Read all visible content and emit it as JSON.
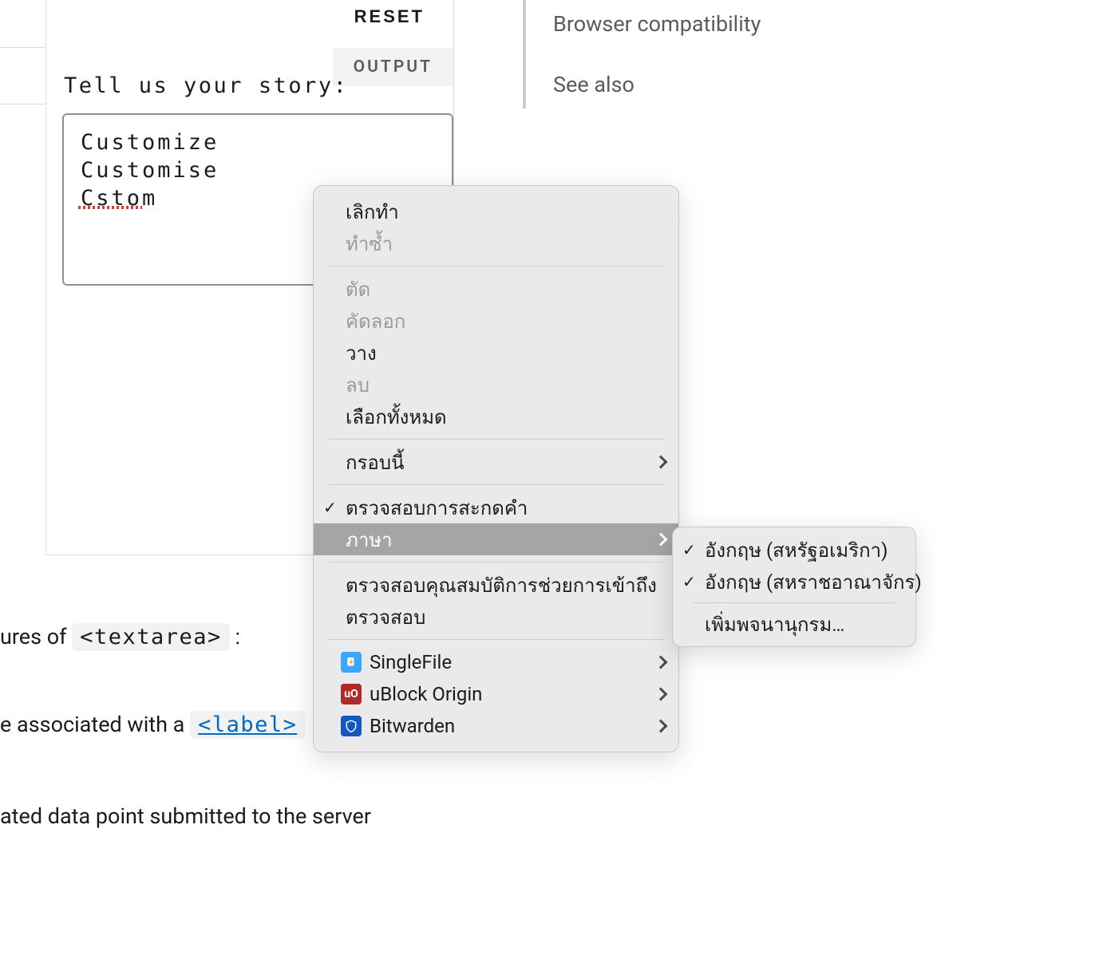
{
  "demo": {
    "reset": "RESET",
    "tab_output": "OUTPUT",
    "label": "Tell us your story:",
    "textarea_value": "Customize\nCustomise\nCstom"
  },
  "toc": {
    "items": [
      "Browser compatibility",
      "See also"
    ]
  },
  "prose": {
    "line1_a": "ures of ",
    "line1_code": "<textarea>",
    "line1_b": " :",
    "line2_a": "e associated with a ",
    "line2_code": "<label>",
    "line3": "ated data point submitted to the server"
  },
  "context_menu": {
    "undo": "เลิกทำ",
    "redo": "ทำซ้ำ",
    "cut": "ตัด",
    "copy": "คัดลอก",
    "paste": "วาง",
    "delete": "ลบ",
    "select_all": "เลือกทั้งหมด",
    "this_frame": "กรอบนี้",
    "check_spell": "ตรวจสอบการสะกดคำ",
    "languages": "ภาษา",
    "check_a11y": "ตรวจสอบคุณสมบัติการช่วยการเข้าถึง",
    "inspect": "ตรวจสอบ",
    "ext_singlefile": "SingleFile",
    "ext_ublock": "uBlock Origin",
    "ext_bitwarden": "Bitwarden"
  },
  "submenu": {
    "en_us": "อังกฤษ (สหรัฐอเมริกา)",
    "en_gb": "อังกฤษ (สหราชอาณาจักร)",
    "add_dict": "เพิ่มพจนานุกรม…"
  }
}
